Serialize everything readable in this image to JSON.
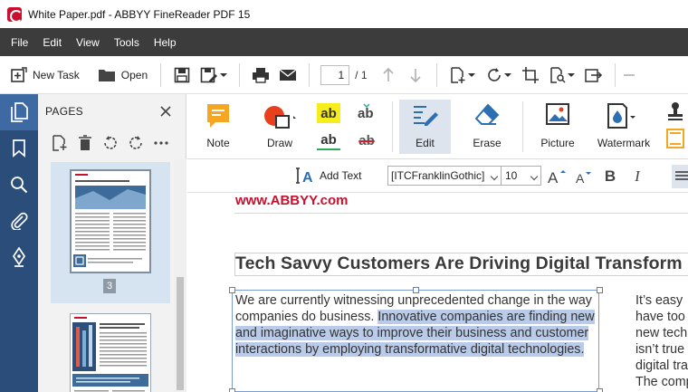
{
  "window": {
    "title": "White Paper.pdf - ABBYY FineReader PDF 15"
  },
  "menu": [
    "File",
    "Edit",
    "View",
    "Tools",
    "Help"
  ],
  "toolbar": {
    "new_task_label": "New Task",
    "open_label": "Open",
    "page_current": "1",
    "page_total": "/ 1"
  },
  "pages_panel": {
    "title": "PAGES",
    "selected_page_label": "3"
  },
  "ribbon": {
    "note_label": "Note",
    "draw_label": "Draw",
    "edit_label": "Edit",
    "erase_label": "Erase",
    "picture_label": "Picture",
    "watermark_label": "Watermark",
    "highlight_glyph": "ab",
    "underline_glyph": "ab",
    "strike_glyph": "ab",
    "insert_glyph": "ab"
  },
  "format_bar": {
    "add_text_label": "Add Text",
    "font_value": "[ITCFranklinGothic]",
    "size_value": "10",
    "bold_glyph": "B",
    "italic_glyph": "I"
  },
  "document": {
    "url": "www.ABBYY.com",
    "heading": "Tech Savvy Customers Are Driving Digital Transform",
    "para_left_plain": "We are currently witnessing unprecedented change in the way companies do business. ",
    "para_left_highlight": "Innovative companies are finding new and imaginative ways to improve their business and customer interactions by employing transformative digital technologies.",
    "para_right_lines": [
      "It’s easy",
      "have too",
      "new tech",
      "isn’t true",
      "digital tra",
      "The comp"
    ]
  },
  "colors": {
    "menubar_bg": "#3c3c3c",
    "rail_bg": "#2b4d7a",
    "accent_red": "#c8102e",
    "highlight": "#b9cbe8"
  }
}
